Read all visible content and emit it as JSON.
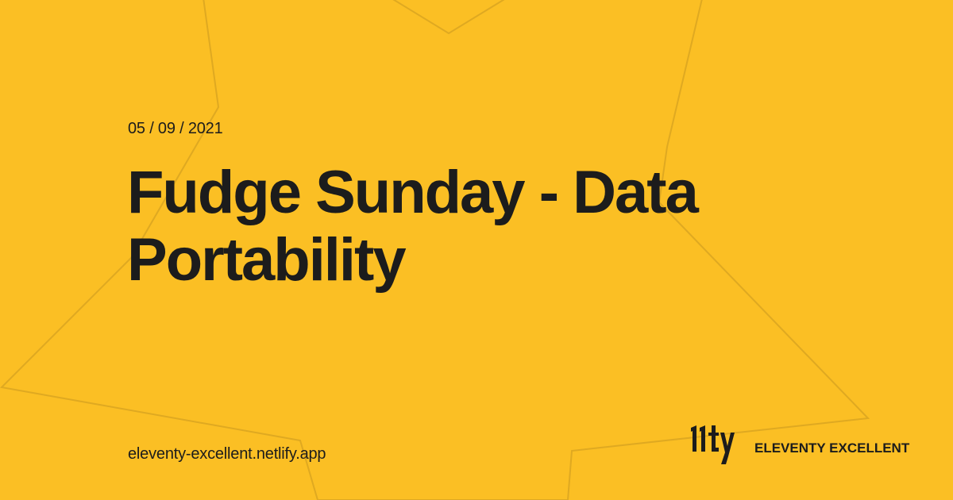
{
  "card": {
    "background_color": "#FBBF24",
    "text_color": "#1c1c1c",
    "date": "05 / 09 / 2021",
    "title": "Fudge Sunday - Data Portability",
    "site_url": "eleventy-excellent.netlify.app"
  },
  "brand": {
    "logo_icon": "11ty-logo-icon",
    "logo_text": "11ty",
    "name": "ELEVENTY EXCELLENT"
  }
}
